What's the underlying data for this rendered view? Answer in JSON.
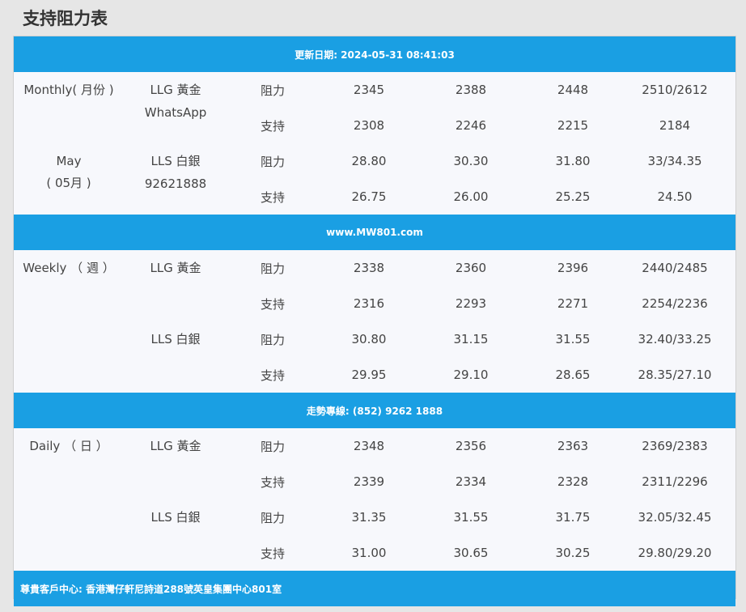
{
  "title": "支持阻力表",
  "banners": {
    "top": "更新日期: 2024-05-31 08:41:03",
    "mid1": "www.MW801.com",
    "mid2": "走勢專線: (852) 9262 1888",
    "bottom": "尊貴客戶中心: 香港灣仔軒尼詩道288號英皇集團中心801室"
  },
  "sections": [
    {
      "period_line1": "Monthly( 月份 )",
      "period_line2": "May",
      "period_line3": "( 05月 )",
      "gold_label": "LLG 黃金",
      "gold_sub": "WhatsApp",
      "silver_label": "LLS 白銀",
      "silver_sub": "92621888",
      "rows": [
        {
          "kind": "阻力",
          "v": [
            "2345",
            "2388",
            "2448",
            "2510/2612"
          ]
        },
        {
          "kind": "支持",
          "v": [
            "2308",
            "2246",
            "2215",
            "2184"
          ]
        },
        {
          "kind": "阻力",
          "v": [
            "28.80",
            "30.30",
            "31.80",
            "33/34.35"
          ]
        },
        {
          "kind": "支持",
          "v": [
            "26.75",
            "26.00",
            "25.25",
            "24.50"
          ]
        }
      ]
    },
    {
      "period_line1": "Weekly （ 週 ）",
      "gold_label": "LLG 黃金",
      "silver_label": "LLS 白銀",
      "rows": [
        {
          "kind": "阻力",
          "v": [
            "2338",
            "2360",
            "2396",
            "2440/2485"
          ]
        },
        {
          "kind": "支持",
          "v": [
            "2316",
            "2293",
            "2271",
            "2254/2236"
          ]
        },
        {
          "kind": "阻力",
          "v": [
            "30.80",
            "31.15",
            "31.55",
            "32.40/33.25"
          ]
        },
        {
          "kind": "支持",
          "v": [
            "29.95",
            "29.10",
            "28.65",
            "28.35/27.10"
          ]
        }
      ]
    },
    {
      "period_line1": "Daily （ 日 ）",
      "gold_label": "LLG 黃金",
      "silver_label": "LLS 白銀",
      "rows": [
        {
          "kind": "阻力",
          "v": [
            "2348",
            "2356",
            "2363",
            "2369/2383"
          ]
        },
        {
          "kind": "支持",
          "v": [
            "2339",
            "2334",
            "2328",
            "2311/2296"
          ]
        },
        {
          "kind": "阻力",
          "v": [
            "31.35",
            "31.55",
            "31.75",
            "32.05/32.45"
          ]
        },
        {
          "kind": "支持",
          "v": [
            "31.00",
            "30.65",
            "30.25",
            "29.80/29.20"
          ]
        }
      ]
    }
  ],
  "colors": {
    "banner": "#1a9fe3",
    "table_bg": "#f7f8fc",
    "page_bg": "#e6e6e6"
  }
}
